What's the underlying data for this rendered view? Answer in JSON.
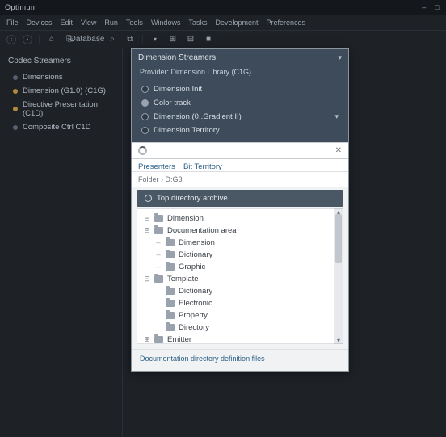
{
  "app": {
    "title": "Optimum"
  },
  "menu": [
    "File",
    "Devices",
    "Edit",
    "View",
    "Run",
    "Tools",
    "Windows",
    "Tasks",
    "Development",
    "Preferences"
  ],
  "toolbar": {
    "back_glyph": "‹",
    "fwd_glyph": "›",
    "items": [
      "⌂",
      "⎘",
      "Database",
      "⌕",
      "⧉",
      "▾",
      "⊞",
      "⊟",
      "■"
    ]
  },
  "sidebar": {
    "title": "Codec Streamers",
    "items": [
      {
        "label": "Dimensions",
        "gold": false
      },
      {
        "label": "Dimension (G1.0) (C1G)",
        "gold": true
      },
      {
        "label": "Directive Presentation (C1D)",
        "gold": true
      },
      {
        "label": "Composite Ctrl C1D",
        "gold": false
      }
    ]
  },
  "panel": {
    "title": "Dimension Streamers",
    "subtitle": "Provider: Dimension Library (C1G)",
    "rows": [
      {
        "label": "Dimension Init",
        "caret": false
      },
      {
        "label": "Color track",
        "caret": false
      },
      {
        "label": "Dimension (0..Gradient II)",
        "caret": true
      },
      {
        "label": "Dimension Territory",
        "caret": false
      }
    ],
    "search_placeholder": "",
    "tabs": [
      "Presenters",
      "Bit Territory"
    ],
    "crumb": "Folder › D:G3",
    "tree_header": "Top directory archive",
    "tree": [
      {
        "d": 0,
        "exp": "⊟",
        "label": "Dimension"
      },
      {
        "d": 0,
        "exp": "⊟",
        "label": "Documentation area"
      },
      {
        "d": 1,
        "exp": "",
        "label": "Dimension",
        "dash": true
      },
      {
        "d": 1,
        "exp": "",
        "label": "Dictionary",
        "dash": true
      },
      {
        "d": 1,
        "exp": "",
        "label": "Graphic",
        "dash": true
      },
      {
        "d": 0,
        "exp": "⊟",
        "label": "Template"
      },
      {
        "d": 1,
        "exp": "",
        "label": "Dictionary"
      },
      {
        "d": 1,
        "exp": "",
        "label": "Electronic"
      },
      {
        "d": 1,
        "exp": "",
        "label": "Property"
      },
      {
        "d": 1,
        "exp": "",
        "label": "Directory"
      },
      {
        "d": 0,
        "exp": "⊞",
        "label": "Emitter"
      }
    ],
    "footer": "Documentation directory definition files"
  }
}
